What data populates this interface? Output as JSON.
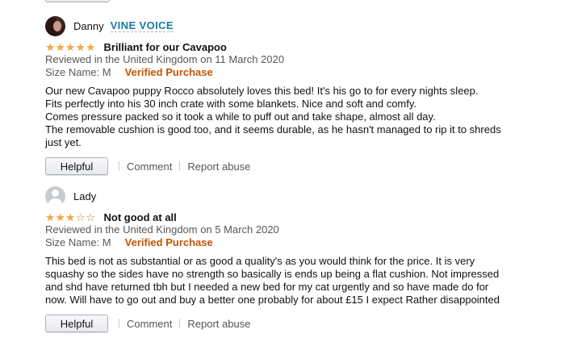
{
  "reviews": [
    {
      "reviewer": "Danny",
      "badge": "VINE VOICE",
      "avatar_icon": "reviewer-photo-icon",
      "stars": 5,
      "rating_text": "",
      "title": "Brilliant for our Cavapoo",
      "date_line": "Reviewed in the United Kingdom on 11 March 2020",
      "variant": "Size Name: M",
      "verified": "Verified Purchase",
      "body": [
        "Our new Cavapoo puppy Rocco absolutely loves this bed! It's his go to for every nights sleep.",
        "Fits perfectly into his 30 inch crate with some blankets. Nice and soft and comfy.",
        "Comes pressure packed so it took a while to puff out and take shape, almost all day.",
        "The removable cushion is good too, and it seems durable, as he hasn't managed to rip it to shreds",
        "just yet."
      ],
      "helpful_label": "Helpful",
      "comment_label": "Comment",
      "report_label": "Report abuse"
    },
    {
      "reviewer": "Lady",
      "badge": "",
      "avatar_icon": "default-user-icon",
      "stars": 3,
      "title": "Not good at all",
      "date_line": "Reviewed in the United Kingdom on 5 March 2020",
      "variant": "Size Name: M",
      "verified": "Verified Purchase",
      "body": [
        "This bed is not as substantial or as good a quality's as you would think for the price. It is very",
        "squashy so the sides have no strength so basically is ends up being a flat cushion. Not impressed",
        "and shd have returned tbh but I needed a new bed for my cat urgently and so have made do for",
        "now. Will have to go out and buy a better one probably for about £15 I expect Rather disappointed"
      ],
      "helpful_label": "Helpful",
      "comment_label": "Comment",
      "report_label": "Report abuse"
    }
  ],
  "colors": {
    "star_fill": "#f3a847",
    "verified": "#c45500",
    "vine_badge": "#1b7aa6",
    "meta_text": "#565959"
  }
}
